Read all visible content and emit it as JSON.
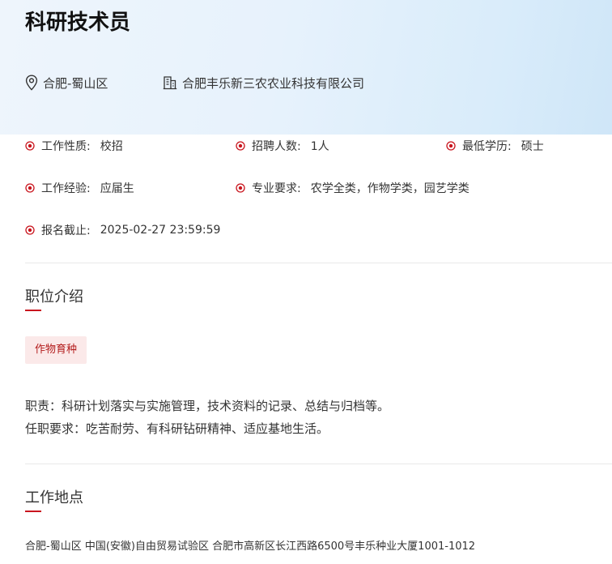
{
  "job": {
    "title": "科研技术员",
    "location": "合肥-蜀山区",
    "company": "合肥丰乐新三农农业科技有限公司"
  },
  "info": {
    "nature_label": "工作性质:",
    "nature_value": "校招",
    "headcount_label": "招聘人数:",
    "headcount_value": "1人",
    "education_label": "最低学历:",
    "education_value": "硕士",
    "experience_label": "工作经验:",
    "experience_value": "应届生",
    "major_label": "专业要求:",
    "major_value": "农学全类，作物学类，园艺学类",
    "deadline_label": "报名截止:",
    "deadline_value": "2025-02-27 23:59:59"
  },
  "intro": {
    "title": "职位介绍",
    "tag": "作物育种",
    "duty": "职责：科研计划落实与实施管理，技术资料的记录、总结与归档等。",
    "requirement": "任职要求：吃苦耐劳、有科研钻研精神、适应基地生活。"
  },
  "workplace": {
    "title": "工作地点",
    "address": "合肥-蜀山区 中国(安徽)自由贸易试验区 合肥市高新区长江西路6500号丰乐种业大厦1001-1012"
  },
  "colors": {
    "accent": "#c9151e",
    "tag_bg": "#fbe9e9",
    "header_bg": "#e7f2fc"
  }
}
